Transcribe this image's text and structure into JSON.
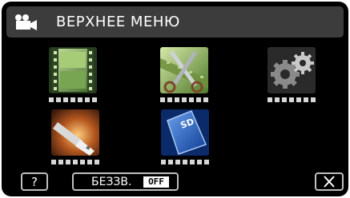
{
  "header": {
    "title": "ВЕРХНЕЕ МЕНЮ",
    "icon": "video-camera-icon"
  },
  "menu_items": [
    {
      "icon": "film-strip-icon"
    },
    {
      "icon": "scissors-film-icon"
    },
    {
      "icon": "settings-gears-icon"
    },
    {
      "icon": "usb-cable-icon"
    },
    {
      "icon": "sd-card-icon",
      "card_label": "SD"
    }
  ],
  "footer": {
    "help_label": "?",
    "mute_label": "БЕЗЗВ.",
    "mute_state": "OFF",
    "close_icon": "close-x-icon"
  }
}
